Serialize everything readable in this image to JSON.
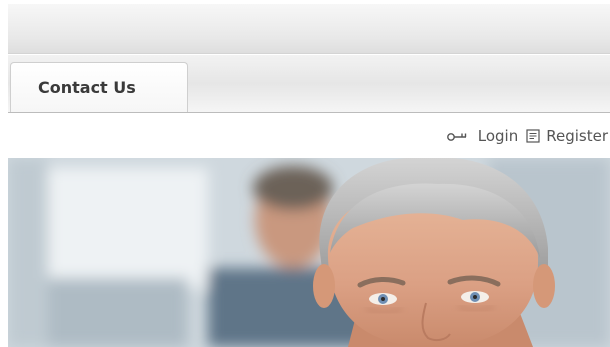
{
  "nav": {
    "tabs": [
      {
        "label": "Contact Us"
      }
    ]
  },
  "user_links": {
    "login_label": "Login",
    "register_label": "Register",
    "login_icon": "key-icon",
    "register_icon": "register-icon"
  },
  "banner": {
    "image": "hero-photo"
  }
}
